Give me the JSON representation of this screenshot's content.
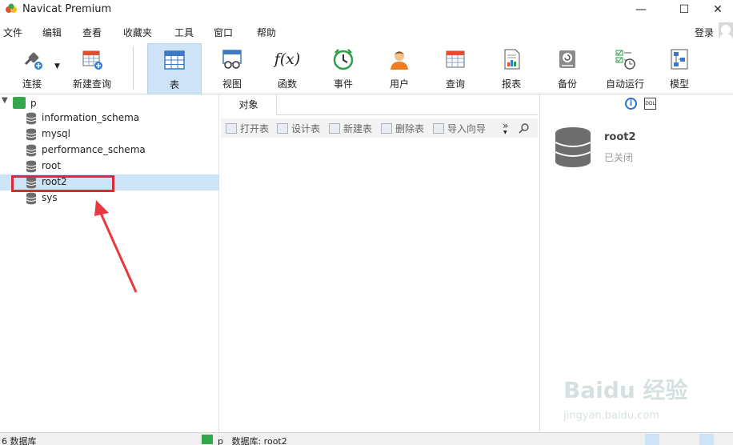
{
  "window": {
    "title": "Navicat Premium",
    "controls": {
      "minimize": "—",
      "maximize": "☐",
      "close": "✕"
    }
  },
  "menu": {
    "items": [
      "文件",
      "编辑",
      "查看",
      "收藏夹",
      "工具",
      "窗口",
      "帮助"
    ],
    "login": "登录"
  },
  "toolbar": {
    "items": [
      {
        "label": "连接",
        "icon": "plug-icon"
      },
      {
        "label": "新建查询",
        "icon": "new-query-icon"
      },
      {
        "label": "表",
        "icon": "table-icon",
        "active": true
      },
      {
        "label": "视图",
        "icon": "view-icon"
      },
      {
        "label": "函数",
        "icon": "function-icon",
        "glyph": "f(x)"
      },
      {
        "label": "事件",
        "icon": "clock-icon"
      },
      {
        "label": "用户",
        "icon": "user-icon"
      },
      {
        "label": "查询",
        "icon": "query-icon"
      },
      {
        "label": "报表",
        "icon": "report-icon"
      },
      {
        "label": "备份",
        "icon": "backup-icon"
      },
      {
        "label": "自动运行",
        "icon": "automation-icon"
      },
      {
        "label": "模型",
        "icon": "model-icon"
      }
    ]
  },
  "sidebar": {
    "connection": "p",
    "databases": [
      "information_schema",
      "mysql",
      "performance_schema",
      "root",
      "root2",
      "sys"
    ],
    "selected": "root2"
  },
  "objects": {
    "tab": "对象",
    "buttons": [
      "打开表",
      "设计表",
      "新建表",
      "删除表",
      "导入向导"
    ],
    "more": "»"
  },
  "details": {
    "name": "root2",
    "status": "已关闭"
  },
  "status": {
    "count": "6 数据库",
    "connection": "p",
    "database": "数据库: root2"
  },
  "watermark": {
    "text": "Baidu 经验",
    "sub": "jingyan.baidu.com"
  },
  "colors": {
    "accent": "#cfe3f6",
    "highlight": "#e0282f",
    "selected_row": "#cce4f7"
  }
}
